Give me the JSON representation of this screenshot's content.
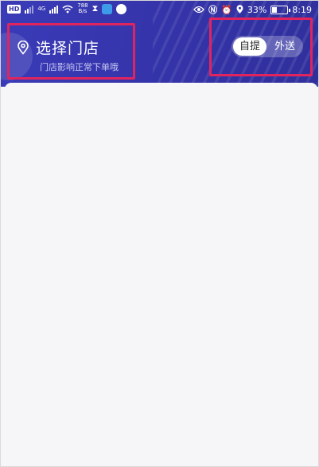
{
  "status_bar": {
    "hd_label": "HD",
    "network_type": "4G",
    "speed_value": "788",
    "speed_unit": "B/s",
    "battery_percent": "33%",
    "battery_level": 0.33,
    "time": "8:19"
  },
  "store_selector": {
    "title": "选择门店",
    "subtitle": "门店影响正常下单哦",
    "icon": "location-pin-icon"
  },
  "mode_toggle": {
    "options": [
      "自提",
      "外送"
    ],
    "selected": "自提"
  },
  "colors": {
    "header_bg": "#3434aa",
    "highlight_border": "#e0245e",
    "content_bg": "#f6f6f8"
  }
}
